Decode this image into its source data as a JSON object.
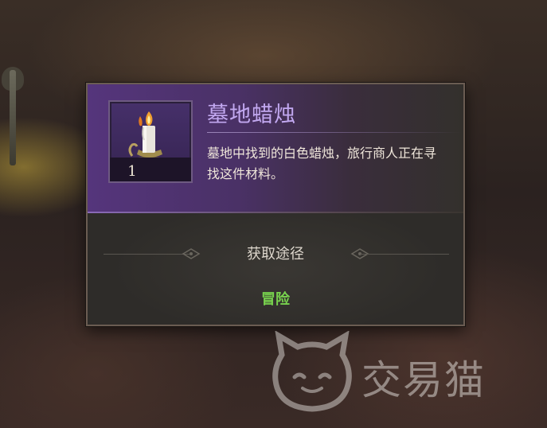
{
  "tooltip": {
    "item_name": "墓地蜡烛",
    "item_count": "1",
    "description": "墓地中找到的白色蜡烛，旅行商人正在寻找这件材料。",
    "source_section_title": "获取途径",
    "source_link": "冒险",
    "colors": {
      "title": "#c2a8f0",
      "header_purple": "#55357c",
      "source_green": "#78d24e"
    },
    "icon": "candle-icon"
  },
  "watermark": {
    "text": "交易猫",
    "icon": "cat-logo-icon"
  }
}
